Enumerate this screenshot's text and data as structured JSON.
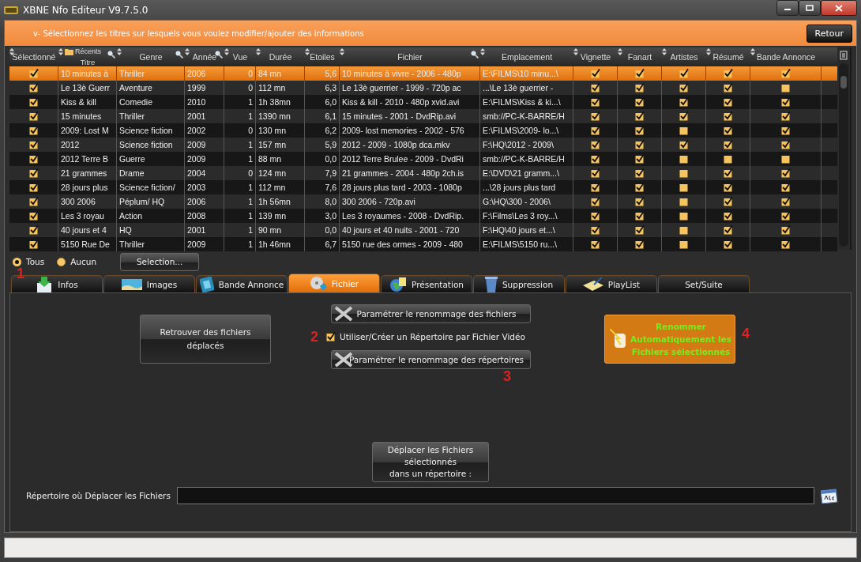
{
  "window": {
    "title": "XBNE Nfo Editeur V9.7.5.0"
  },
  "banner": {
    "text": "v- Sélectionnez les titres sur lesquels vous voulez modifier/ajouter des informations",
    "button": "Retour"
  },
  "table": {
    "recent_label": "Récents",
    "columns": [
      {
        "label": "Sélectionné"
      },
      {
        "label": "Titre"
      },
      {
        "label": "Genre"
      },
      {
        "label": "Année"
      },
      {
        "label": "Vue"
      },
      {
        "label": "Durée"
      },
      {
        "label": "Etoiles"
      },
      {
        "label": "Fichier"
      },
      {
        "label": "Emplacement"
      },
      {
        "label": "Vignette"
      },
      {
        "label": "Fanart"
      },
      {
        "label": "Artistes"
      },
      {
        "label": "Résumé"
      },
      {
        "label": "Bande Annonce"
      }
    ],
    "rows": [
      {
        "selected": true,
        "checked": true,
        "titre": "10 minutes à",
        "genre": "Thriller",
        "annee": "2006",
        "vue": "0",
        "duree": "84 mn",
        "etoiles": "5,6",
        "fichier": "10 minutes à vivre - 2006 - 480p",
        "emplacement": "E:\\FILMS\\10 minu...\\",
        "vignette": true,
        "fanart": true,
        "artistes": true,
        "resume": true,
        "bande_annonce": true
      },
      {
        "selected": false,
        "checked": true,
        "titre": "Le 13è Guerr",
        "genre": "Aventure",
        "annee": "1999",
        "vue": "0",
        "duree": "112 mn",
        "etoiles": "6,3",
        "fichier": "Le 13è guerrier - 1999 - 720p ac",
        "emplacement": "...\\Le 13è guerrier -",
        "vignette": true,
        "fanart": true,
        "artistes": true,
        "resume": true,
        "bande_annonce": false
      },
      {
        "selected": false,
        "checked": true,
        "titre": "Kiss & kill",
        "genre": "Comedie",
        "annee": "2010",
        "vue": "1",
        "duree": "1h 38mn",
        "etoiles": "6,0",
        "fichier": "Kiss & kill - 2010 - 480p xvid.avi",
        "emplacement": "E:\\FILMS\\Kiss & ki...\\",
        "vignette": true,
        "fanart": true,
        "artistes": true,
        "resume": true,
        "bande_annonce": true
      },
      {
        "selected": false,
        "checked": true,
        "titre": "15 minutes",
        "genre": "Thriller",
        "annee": "2001",
        "vue": "1",
        "duree": "1390 mn",
        "etoiles": "6,1",
        "fichier": "15 minutes - 2001 - DvdRip.avi",
        "emplacement": "smb://PC-K-BARRE/H",
        "vignette": true,
        "fanart": true,
        "artistes": true,
        "resume": true,
        "bande_annonce": true
      },
      {
        "selected": false,
        "checked": true,
        "titre": "2009: Lost M",
        "genre": "Science fiction",
        "annee": "2002",
        "vue": "0",
        "duree": "130 mn",
        "etoiles": "6,2",
        "fichier": "2009- lost memories - 2002 - 576",
        "emplacement": "E:\\FILMS\\2009- lo...\\",
        "vignette": true,
        "fanart": true,
        "artistes": false,
        "resume": true,
        "bande_annonce": true
      },
      {
        "selected": false,
        "checked": true,
        "titre": "2012",
        "genre": "Science fiction",
        "annee": "2009",
        "vue": "1",
        "duree": "157 mn",
        "etoiles": "5,9",
        "fichier": "2012 - 2009 - 1080p dca.mkv",
        "emplacement": "F:\\HQ\\2012 - 2009\\",
        "vignette": true,
        "fanart": true,
        "artistes": true,
        "resume": true,
        "bande_annonce": true
      },
      {
        "selected": false,
        "checked": true,
        "titre": "2012 Terre B",
        "genre": "Guerre",
        "annee": "2009",
        "vue": "1",
        "duree": "88 mn",
        "etoiles": "0,0",
        "fichier": "2012 Terre Brulee - 2009 - DvdRi",
        "emplacement": "smb://PC-K-BARRE/H",
        "vignette": true,
        "fanart": true,
        "artistes": false,
        "resume": false,
        "bande_annonce": false
      },
      {
        "selected": false,
        "checked": true,
        "titre": "21 grammes",
        "genre": "Drame",
        "annee": "2004",
        "vue": "0",
        "duree": "124 mn",
        "etoiles": "7,9",
        "fichier": "21 grammes - 2004 - 480p 2ch.is",
        "emplacement": "E:\\DVD\\21 gramm...\\",
        "vignette": true,
        "fanart": true,
        "artistes": false,
        "resume": true,
        "bande_annonce": true
      },
      {
        "selected": false,
        "checked": true,
        "titre": "28 jours plus",
        "genre": "Science fiction/",
        "annee": "2003",
        "vue": "1",
        "duree": "112 mn",
        "etoiles": "7,6",
        "fichier": "28 jours plus tard - 2003 - 1080p",
        "emplacement": "...\\28 jours plus tard",
        "vignette": true,
        "fanart": true,
        "artistes": false,
        "resume": true,
        "bande_annonce": true
      },
      {
        "selected": false,
        "checked": true,
        "titre": "300 2006",
        "genre": "Péplum/ HQ",
        "annee": "2006",
        "vue": "1",
        "duree": "1h 56mn",
        "etoiles": "8,0",
        "fichier": "300 2006 - 720p.avi",
        "emplacement": "G:\\HQ\\300 - 2006\\",
        "vignette": true,
        "fanart": true,
        "artistes": false,
        "resume": true,
        "bande_annonce": true
      },
      {
        "selected": false,
        "checked": true,
        "titre": "Les 3 royau",
        "genre": "Action",
        "annee": "2008",
        "vue": "1",
        "duree": "139 mn",
        "etoiles": "3,0",
        "fichier": "Les 3 royaumes - 2008 - DvdRip.",
        "emplacement": "F:\\Films\\Les 3 roy...\\",
        "vignette": true,
        "fanart": true,
        "artistes": false,
        "resume": true,
        "bande_annonce": true
      },
      {
        "selected": false,
        "checked": true,
        "titre": "40 jours et 4",
        "genre": "HQ",
        "annee": "2001",
        "vue": "1",
        "duree": "90 mn",
        "etoiles": "0,0",
        "fichier": "40 jours et 40 nuits - 2001 - 720",
        "emplacement": "F:\\HQ\\40 jours et...\\",
        "vignette": true,
        "fanart": true,
        "artistes": false,
        "resume": true,
        "bande_annonce": true
      },
      {
        "selected": false,
        "checked": true,
        "titre": "5150 Rue De",
        "genre": "Thriller",
        "annee": "2009",
        "vue": "1",
        "duree": "1h 46mn",
        "etoiles": "6,7",
        "fichier": "5150 rue des ormes - 2009 - 480",
        "emplacement": "E:\\FILMS\\5150 ru...\\",
        "vignette": true,
        "fanart": true,
        "artistes": false,
        "resume": true,
        "bande_annonce": true
      }
    ]
  },
  "selection": {
    "radios": [
      {
        "label": "Tous",
        "selected": true
      },
      {
        "label": "Aucun",
        "selected": false
      }
    ],
    "button": "Selection..."
  },
  "tabs": [
    {
      "label": "Infos",
      "selected": false
    },
    {
      "label": "Images",
      "selected": false
    },
    {
      "label": "Bande Annonce",
      "selected": false
    },
    {
      "label": "Fichier",
      "selected": true
    },
    {
      "label": "Présentation",
      "selected": false
    },
    {
      "label": "Suppression",
      "selected": false
    },
    {
      "label": "PlayList",
      "selected": false
    },
    {
      "label": "Set/Suite",
      "selected": false
    }
  ],
  "markers": [
    "1",
    "2",
    "3",
    "4"
  ],
  "panel": {
    "find_button": "Retrouver des fichiers déplacés",
    "rename_files_button": "Paramétrer le renommage des fichiers",
    "folder_option": {
      "label": "Utiliser/Créer un Répertoire par Fichier Vidéo",
      "checked": true
    },
    "rename_folders_button": "Paramétrer le renommage des répertoires",
    "auto_rename_button": [
      "Renommer",
      "Automatiquement les",
      "Fichiers sélectionnés"
    ],
    "move_button": [
      "Déplacer les Fichiers",
      "sélectionnés",
      "dans un répertoire :"
    ],
    "folder_field": {
      "label": "Répertoire où Déplacer les Fichiers"
    }
  }
}
